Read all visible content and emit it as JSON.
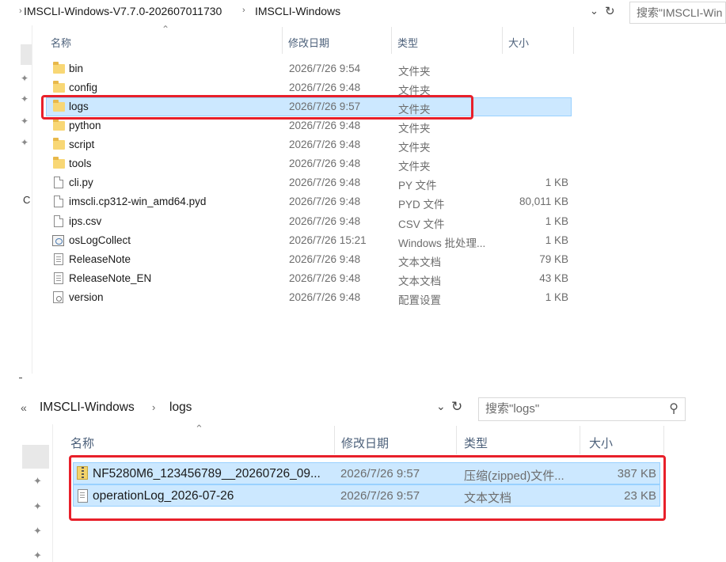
{
  "top": {
    "breadcrumb": [
      "IMSCLI-Windows-V7.7.0-202607011730",
      "IMSCLI-Windows"
    ],
    "search_placeholder": "搜索\"IMSCLI-Win",
    "columns": {
      "name": "名称",
      "date": "修改日期",
      "type": "类型",
      "size": "大小"
    },
    "rows": [
      {
        "name": "bin",
        "date": "2026/7/26 9:54",
        "type": "文件夹",
        "size": "",
        "icon": "folder-icon"
      },
      {
        "name": "config",
        "date": "2026/7/26 9:48",
        "type": "文件夹",
        "size": "",
        "icon": "folder-icon"
      },
      {
        "name": "logs",
        "date": "2026/7/26 9:57",
        "type": "文件夹",
        "size": "",
        "icon": "folder-icon",
        "selected": true
      },
      {
        "name": "python",
        "date": "2026/7/26 9:48",
        "type": "文件夹",
        "size": "",
        "icon": "folder-icon"
      },
      {
        "name": "script",
        "date": "2026/7/26 9:48",
        "type": "文件夹",
        "size": "",
        "icon": "folder-icon"
      },
      {
        "name": "tools",
        "date": "2026/7/26 9:48",
        "type": "文件夹",
        "size": "",
        "icon": "folder-icon"
      },
      {
        "name": "cli.py",
        "date": "2026/7/26 9:48",
        "type": "PY 文件",
        "size": "1 KB",
        "icon": "file-icon"
      },
      {
        "name": "imscli.cp312-win_amd64.pyd",
        "date": "2026/7/26 9:48",
        "type": "PYD 文件",
        "size": "80,011 KB",
        "icon": "file-icon"
      },
      {
        "name": "ips.csv",
        "date": "2026/7/26 9:48",
        "type": "CSV 文件",
        "size": "1 KB",
        "icon": "file-icon"
      },
      {
        "name": "osLogCollect",
        "date": "2026/7/26 15:21",
        "type": "Windows 批处理...",
        "size": "1 KB",
        "icon": "batch-file-icon"
      },
      {
        "name": "ReleaseNote",
        "date": "2026/7/26 9:48",
        "type": "文本文档",
        "size": "79 KB",
        "icon": "text-document-icon"
      },
      {
        "name": "ReleaseNote_EN",
        "date": "2026/7/26 9:48",
        "type": "文本文档",
        "size": "43 KB",
        "icon": "text-document-icon"
      },
      {
        "name": "version",
        "date": "2026/7/26 9:48",
        "type": "配置设置",
        "size": "1 KB",
        "icon": "config-file-icon"
      }
    ],
    "left_edge_letter": "C"
  },
  "bottom": {
    "breadcrumb": [
      "IMSCLI-Windows",
      "logs"
    ],
    "search_placeholder": "搜索\"logs\"",
    "columns": {
      "name": "名称",
      "date": "修改日期",
      "type": "类型",
      "size": "大小"
    },
    "rows": [
      {
        "name": "NF5280M6_123456789__20260726_09...",
        "date": "2026/7/26 9:57",
        "type": "压缩(zipped)文件...",
        "size": "387 KB",
        "icon": "zip-folder-icon",
        "selected": true
      },
      {
        "name": "operationLog_2026-07-26",
        "date": "2026/7/26 9:57",
        "type": "文本文档",
        "size": "23 KB",
        "icon": "text-document-icon",
        "selected": true
      }
    ]
  },
  "colors": {
    "selection": "#cce8ff",
    "highlight_box": "#e8202a",
    "folder": "#f8d775"
  }
}
